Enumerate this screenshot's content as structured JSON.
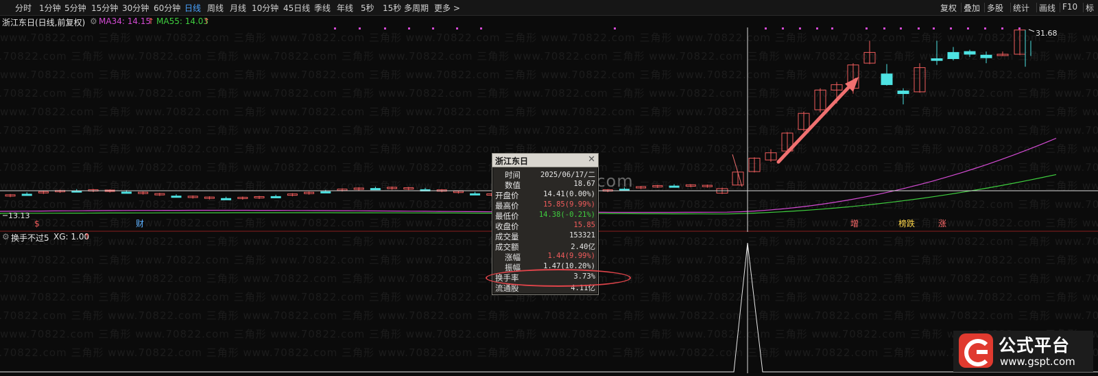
{
  "toolbar": {
    "left_items": [
      "分时",
      "1分钟",
      "5分钟",
      "15分钟",
      "30分钟",
      "60分钟",
      "日线",
      "周线",
      "月线",
      "10分钟",
      "45日线",
      "季线",
      "年线",
      "5秒",
      "15秒",
      "多周期",
      "更多 >"
    ],
    "active": "日线",
    "right_items": [
      "复权",
      "叠加",
      "多股",
      "统计",
      "画线",
      "F10",
      "标"
    ]
  },
  "info": {
    "title": "浙江东日(日线,前复权)",
    "ma34": "MA34: 14.15",
    "ma55": "MA55: 14.03",
    "colors": {
      "ma34": "#d44bd4",
      "ma55": "#3fcf3f",
      "up": "#f25c5c",
      "down": "#4ee3e3"
    }
  },
  "chart": {
    "high_label": "31.68",
    "low_label": "13.13",
    "markers": [
      {
        "text": "$",
        "color": "#f25c5c"
      },
      {
        "text": "财",
        "color": "#5ab0ff"
      },
      {
        "text": "增",
        "color": "#ff6b6b"
      },
      {
        "text": "榜跌",
        "color": "#ffd84a"
      },
      {
        "text": "涨",
        "color": "#ff6b6b"
      }
    ]
  },
  "sub": {
    "name": "换手不过5",
    "xg": "XG: 1.00"
  },
  "popup": {
    "title": "浙江东日",
    "rows": [
      {
        "label": "时间",
        "value": "2025/06/17/二",
        "color": "#e6e6e6"
      },
      {
        "label": "数值",
        "value": "18.67",
        "color": "#e6e6e6"
      },
      {
        "label": "开盘价",
        "value": "14.41(0.00%)",
        "color": "#e6e6e6"
      },
      {
        "label": "最高价",
        "value": "15.85(9.99%)",
        "color": "#f25c5c"
      },
      {
        "label": "最低价",
        "value": "14.38(-0.21%)",
        "color": "#3fcf3f"
      },
      {
        "label": "收盘价",
        "value": "15.85",
        "color": "#f25c5c"
      },
      {
        "label": "成交量",
        "value": "153321",
        "color": "#e6e6e6"
      },
      {
        "label": "成交额",
        "value": "2.40亿",
        "color": "#e6e6e6"
      },
      {
        "label": "涨幅",
        "value": "1.44(9.99%)",
        "color": "#f25c5c"
      },
      {
        "label": "振幅",
        "value": "1.47(10.20%)",
        "color": "#e6e6e6"
      },
      {
        "label": "换手率",
        "value": "3.73%",
        "color": "#e6e6e6"
      },
      {
        "label": "流通股",
        "value": "4.11亿",
        "color": "#e6e6e6"
      }
    ]
  },
  "watermark": "www.gspt.com",
  "logo": {
    "big": "公式平台",
    "small": "www.gspt.com"
  }
}
